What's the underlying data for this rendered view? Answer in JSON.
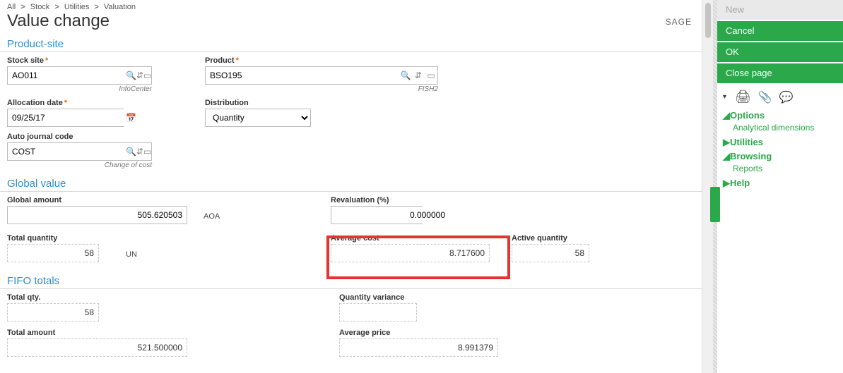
{
  "breadcrumb": [
    "All",
    "Stock",
    "Utilities",
    "Valuation"
  ],
  "page_title": "Value change",
  "brand": "SAGE",
  "sections": {
    "product_site": "Product-site",
    "global_value": "Global value",
    "fifo_totals": "FIFO totals"
  },
  "fields": {
    "stock_site": {
      "label": "Stock site",
      "value": "AO011",
      "helper": "InfoCenter"
    },
    "product": {
      "label": "Product",
      "value": "BSO195",
      "helper": "FISH2"
    },
    "allocation_date": {
      "label": "Allocation date",
      "value": "09/25/17"
    },
    "distribution": {
      "label": "Distribution",
      "value": "Quantity"
    },
    "auto_journal": {
      "label": "Auto journal code",
      "value": "COST",
      "helper": "Change of cost"
    }
  },
  "global": {
    "global_amount": {
      "label": "Global amount",
      "value": "505.620503",
      "unit": "AOA"
    },
    "revaluation": {
      "label": "Revaluation (%)",
      "value": "0.000000"
    },
    "total_qty": {
      "label": "Total quantity",
      "value": "58",
      "unit": "UN"
    },
    "avg_cost": {
      "label": "Average cost",
      "value": "8.717600"
    },
    "active_qty": {
      "label": "Active quantity",
      "value": "58"
    }
  },
  "fifo": {
    "total_qty": {
      "label": "Total qty.",
      "value": "58"
    },
    "qty_var": {
      "label": "Quantity variance",
      "value": ""
    },
    "total_amount": {
      "label": "Total amount",
      "value": "521.500000"
    },
    "avg_price": {
      "label": "Average price",
      "value": "8.991379"
    }
  },
  "side": {
    "new": "New",
    "cancel": "Cancel",
    "ok": "OK",
    "close": "Close page",
    "options": "Options",
    "analytical": "Analytical dimensions",
    "utilities": "Utilities",
    "browsing": "Browsing",
    "reports": "Reports",
    "help": "Help"
  }
}
